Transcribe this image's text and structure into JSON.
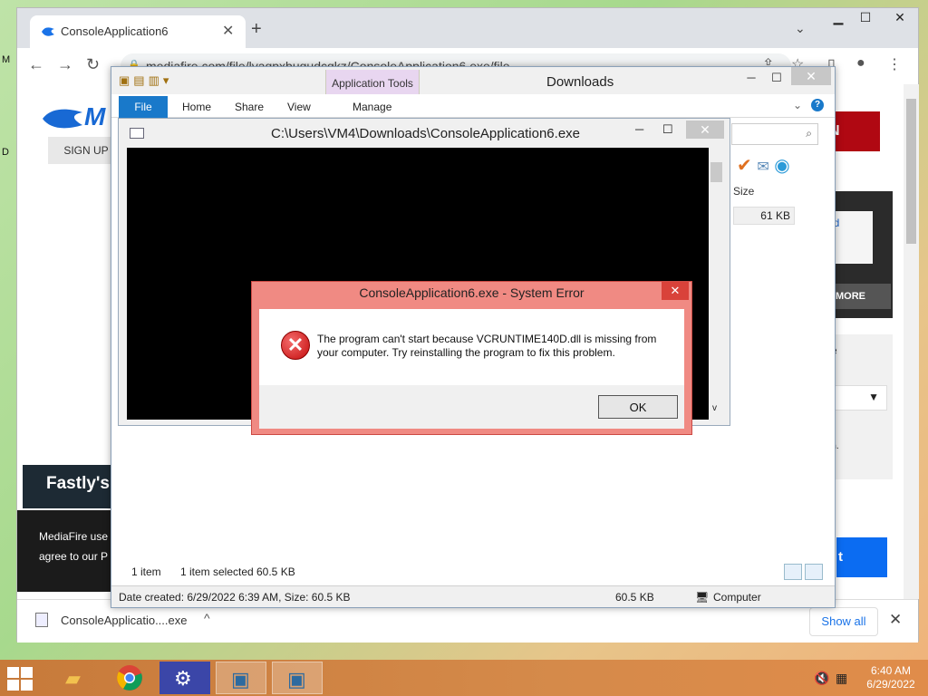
{
  "desktop": {
    "edge_labels": [
      "M",
      "D"
    ]
  },
  "browser": {
    "tab": {
      "title": "ConsoleApplication6",
      "close": "✕"
    },
    "new_tab": "+",
    "tab_search": "⌄",
    "window_controls": {
      "minimize": "▁",
      "maximize": "☐",
      "close": "✕"
    },
    "nav": {
      "back": "←",
      "forward": "→",
      "reload": "↻"
    },
    "url": "mediafire.com/file/lyaqpxbuqudcqkz/ConsoleApplication6.exe/file",
    "toolbar_icons": {
      "share": "⇪",
      "star": "☆",
      "sidebar": "▯",
      "profile": "●",
      "menu": "⋮"
    }
  },
  "mediafire": {
    "logo": "M",
    "signup": "SIGN UP",
    "download_btn": "N",
    "card_text": "ad",
    "learn_more": "N MORE",
    "panel_exe": "xe",
    "panel_note_1": "he",
    "panel_note_2": "em.",
    "blue_btn": "t",
    "fastly": "Fastly's",
    "cookie_1": "MediaFire use",
    "cookie_2": "agree to our P"
  },
  "download_bar": {
    "filename": "ConsoleApplicatio....exe",
    "chevron": "^",
    "show_all": "Show all",
    "close": "✕"
  },
  "explorer": {
    "title": "Downloads",
    "app_tools": "Application Tools",
    "tabs": {
      "file": "File",
      "home": "Home",
      "share": "Share",
      "view": "View",
      "manage": "Manage"
    },
    "controls": {
      "minimize": "─",
      "maximize": "☐",
      "close": "✕"
    },
    "search_icon": "⌕",
    "column_size": "Size",
    "file_size": "61 KB",
    "status": {
      "items": "1 item",
      "selected": "1 item selected",
      "sel_size": "60.5 KB"
    },
    "details": {
      "created": "Date created: 6/29/2022 6:39 AM, Size: 60.5 KB",
      "size": "60.5 KB",
      "location": "Computer"
    }
  },
  "console": {
    "title": "C:\\Users\\VM4\\Downloads\\ConsoleApplication6.exe",
    "controls": {
      "minimize": "─",
      "maximize": "☐",
      "close": "✕"
    },
    "scroll_down": "v"
  },
  "error_dialog": {
    "title": "ConsoleApplication6.exe - System Error",
    "close": "✕",
    "icon": "✕",
    "message": "The program can't start because VCRUNTIME140D.dll is missing from your computer. Try reinstalling the program to fix this problem.",
    "ok": "OK"
  },
  "taskbar": {
    "time": "6:40 AM",
    "date": "6/29/2022",
    "sound_icon": "🔇",
    "network_icon": "▦"
  }
}
